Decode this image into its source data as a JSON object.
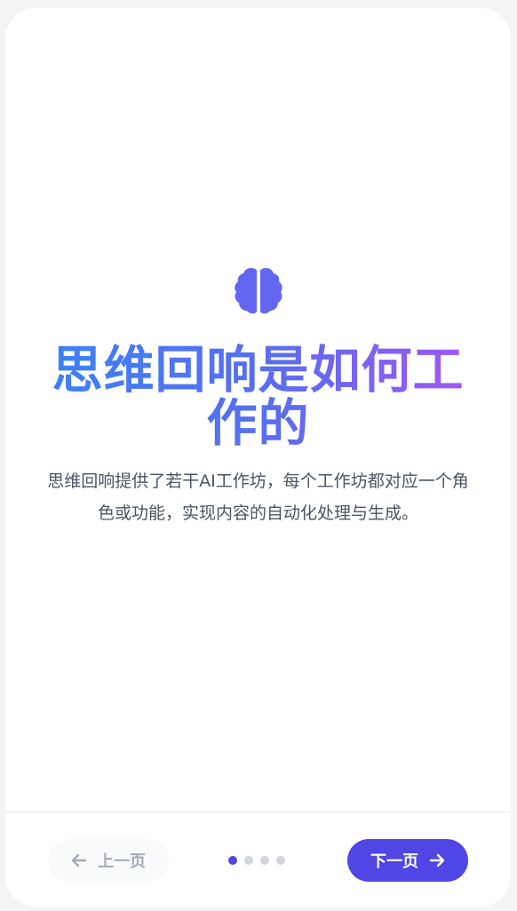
{
  "slide": {
    "icon": "brain-icon",
    "title": "思维回响是如何工作的",
    "description": "思维回响提供了若干AI工作坊，每个工作坊都对应一个角色或功能，实现内容的自动化处理与生成。"
  },
  "navigation": {
    "prev_label": "上一页",
    "next_label": "下一页",
    "prev_icon": "arrow-left-icon",
    "next_icon": "arrow-right-icon",
    "page_count": 4,
    "current_page": 1
  },
  "colors": {
    "accent": "#4f46e5",
    "title_gradient_start": "#3b82f6",
    "title_gradient_end": "#a855f7",
    "text": "#4b5563",
    "inactive_dot": "#d1d5db"
  }
}
